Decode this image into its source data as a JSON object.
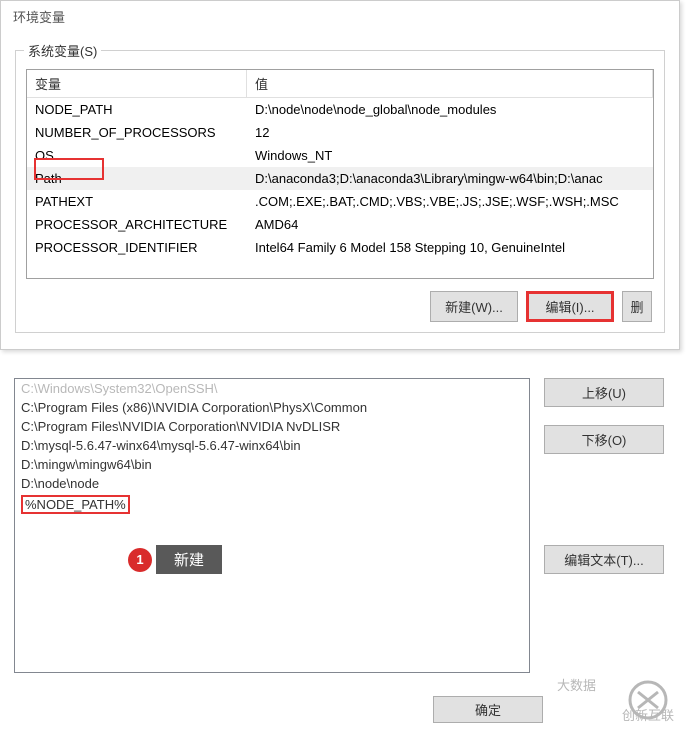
{
  "window_title": "环境变量",
  "group_label": "系统变量(S)",
  "columns": {
    "var": "变量",
    "val": "值"
  },
  "rows": [
    {
      "name": "NODE_PATH",
      "value": "D:\\node\\node\\node_global\\node_modules"
    },
    {
      "name": "NUMBER_OF_PROCESSORS",
      "value": "12"
    },
    {
      "name": "OS",
      "value": "Windows_NT"
    },
    {
      "name": "Path",
      "value": "D:\\anaconda3;D:\\anaconda3\\Library\\mingw-w64\\bin;D:\\anac"
    },
    {
      "name": "PATHEXT",
      "value": ".COM;.EXE;.BAT;.CMD;.VBS;.VBE;.JS;.JSE;.WSF;.WSH;.MSC"
    },
    {
      "name": "PROCESSOR_ARCHITECTURE",
      "value": "AMD64"
    },
    {
      "name": "PROCESSOR_IDENTIFIER",
      "value": "Intel64 Family 6 Model 158 Stepping 10, GenuineIntel"
    }
  ],
  "buttons": {
    "new": "新建(W)...",
    "edit": "编辑(I)...",
    "delete": "删"
  },
  "path_items": [
    "C:\\Windows\\System32\\OpenSSH\\",
    "C:\\Program Files (x86)\\NVIDIA Corporation\\PhysX\\Common",
    "C:\\Program Files\\NVIDIA Corporation\\NVIDIA NvDLISR",
    "D:\\mysql-5.6.47-winx64\\mysql-5.6.47-winx64\\bin",
    "D:\\mingw\\mingw64\\bin",
    "D:\\node\\node",
    "%NODE_PATH%"
  ],
  "lower_buttons": {
    "up": "上移(U)",
    "down": "下移(O)",
    "edit_text": "编辑文本(T)..."
  },
  "annotation": {
    "num": "1",
    "label": "新建"
  },
  "ok_button": "确定",
  "watermark": "大数据",
  "logo_text": "创新互联"
}
